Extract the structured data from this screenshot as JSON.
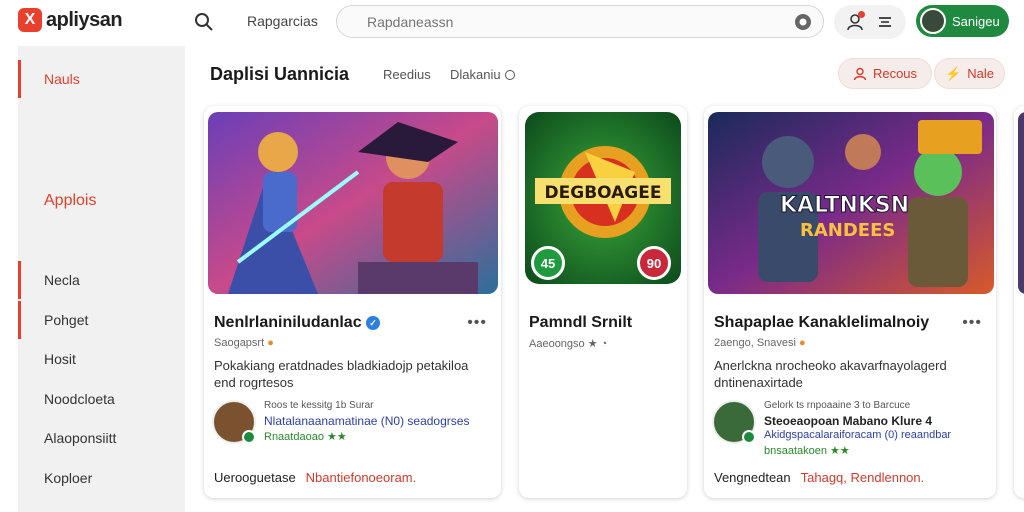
{
  "header": {
    "logo_mark": "X",
    "logo_text": "apliysan",
    "nav_link": "Rapgarcias",
    "search_placeholder": "Rapdaneassn",
    "user_label": "Sanigeu"
  },
  "sidebar": {
    "items": [
      {
        "label": "Nauls"
      },
      {
        "label": "Applois"
      },
      {
        "label": "Necla"
      },
      {
        "label": "Pohget"
      },
      {
        "label": "Hosit"
      },
      {
        "label": "Noodcloeta"
      },
      {
        "label": "Alaoponsiitt"
      },
      {
        "label": "Koploer"
      }
    ]
  },
  "main": {
    "title": "Daplisi  Uannicia",
    "link1": "Reedius",
    "link2": "Dlakaniu",
    "btn_recent": "Recous",
    "btn_more": "Nale"
  },
  "cards": [
    {
      "title": "Nenlrlaniniludanlac",
      "meta": "Saogapsrt",
      "desc": "Pokakiang eratdnades bladkiadojp petakiloa end rogrtesos",
      "review_l1": "Roos te kessitg 1b  Surar",
      "review_l2": "Nlatalanaanamatinae (N0)  seadogrses",
      "review_l3": "Rnaatdaoao ★★",
      "foot": "Uerooguetase",
      "foot_red": "Nbantiefonoeoram."
    },
    {
      "title": "Pamndl Srnilt",
      "meta": "Aaeoongso ★ ◔",
      "art_text": "DEGBOAGEE",
      "badge_left": "45",
      "badge_right": "90"
    },
    {
      "title": "Shapaplae Kanaklelimalnoiy",
      "meta": "2aengo, Snavesi",
      "desc": "Anerlckna nrocheoko akavarfnayolagerd dntinenaxirtade",
      "art_text_1": "KALTNKSN",
      "art_text_2": "RANDEES",
      "review_l1": "Gelork ts rnpoaaine 3 to Barcuce",
      "review_l2": "Steoeaopoan  Mabano Klure 4",
      "review_l3": "Akidgspacalaraiforacam (0)  reaandbar",
      "review_l4": "bnsaatakoen ★★",
      "foot": "Vengnedtean",
      "foot_red": "Tahagq, Rendlennon."
    }
  ],
  "colors": {
    "accent": "#e8402c",
    "user_green": "#1f8a3f"
  }
}
